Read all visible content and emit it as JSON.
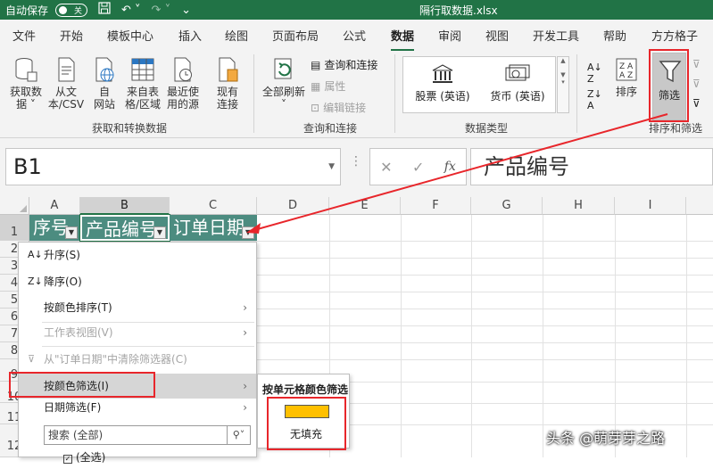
{
  "titlebar": {
    "autosave_label": "自动保存",
    "toggle_state": "关",
    "filename": "隔行取数据.xlsx",
    "save_icon": "save-icon",
    "undo_icon": "undo-icon",
    "redo_icon": "redo-icon"
  },
  "tabs": [
    {
      "label": "文件"
    },
    {
      "label": "开始"
    },
    {
      "label": "模板中心"
    },
    {
      "label": "插入"
    },
    {
      "label": "绘图"
    },
    {
      "label": "页面布局"
    },
    {
      "label": "公式"
    },
    {
      "label": "数据",
      "active": true
    },
    {
      "label": "审阅"
    },
    {
      "label": "视图"
    },
    {
      "label": "开发工具"
    },
    {
      "label": "帮助"
    },
    {
      "label": "方方格子"
    }
  ],
  "ribbon": {
    "get_data": {
      "line1": "获取数",
      "line2": "据 ˅"
    },
    "from_text": {
      "line1": "从文",
      "line2": "本/CSV"
    },
    "from_web": {
      "line1": "自",
      "line2": "网站"
    },
    "from_table": {
      "line1": "来自表",
      "line2": "格/区域"
    },
    "recent": {
      "line1": "最近使",
      "line2": "用的源"
    },
    "existing": {
      "line1": "现有",
      "line2": "连接"
    },
    "group1_label": "获取和转换数据",
    "refresh_all": {
      "line1": "全部刷新",
      "line2": "˅"
    },
    "queries_connections": "查询和连接",
    "properties": "属性",
    "edit_links": "编辑链接",
    "group2_label": "查询和连接",
    "stocks": "股票 (英语)",
    "currency": "货币 (英语)",
    "group3_label": "数据类型",
    "sort": "排序",
    "filter": "筛选",
    "group4_label": "排序和筛选"
  },
  "formula_bar": {
    "name_box": "B1",
    "content": "产品编号",
    "fx": "fx"
  },
  "grid": {
    "columns": [
      "A",
      "B",
      "C",
      "D",
      "E",
      "F",
      "G",
      "H",
      "I"
    ],
    "rows": [
      "1",
      "2",
      "3",
      "4",
      "5",
      "6",
      "7",
      "8",
      "9",
      "10",
      "11",
      "12"
    ],
    "header_cells": [
      "序号",
      "产品编号",
      "订单日期"
    ]
  },
  "menu": {
    "sort_asc": "升序(S)",
    "sort_desc": "降序(O)",
    "sort_by_color": "按颜色排序(T)",
    "sheet_view": "工作表视图(V)",
    "clear_filter": "从\"订单日期\"中清除筛选器(C)",
    "filter_by_color": "按颜色筛选(I)",
    "date_filter": "日期筛选(F)",
    "search_placeholder": "搜索 (全部)",
    "select_all": "(全选)"
  },
  "submenu": {
    "title": "按单元格颜色筛选",
    "swatch_color": "#ffc000",
    "no_fill": "无填充"
  },
  "watermark": "头条 @萌芽芽之路",
  "colors": {
    "accent": "#217346",
    "header_fill": "#4c8c80",
    "annotation": "#e8262b"
  }
}
